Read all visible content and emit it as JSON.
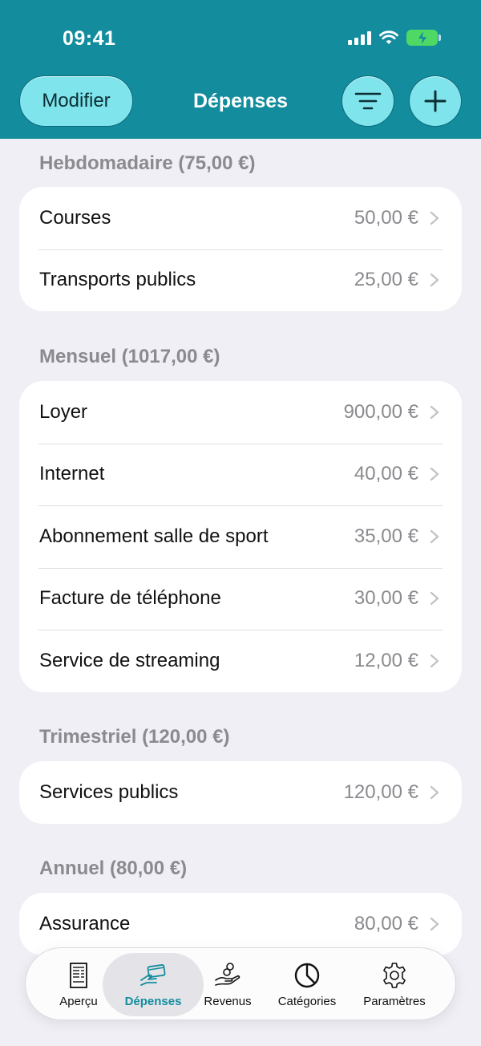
{
  "status_bar": {
    "time": "09:41"
  },
  "nav": {
    "edit_label": "Modifier",
    "title": "Dépenses",
    "filter_icon": "filter-lines-icon",
    "add_icon": "plus-icon"
  },
  "sections": [
    {
      "title": "Hebdomadaire (75,00 €)",
      "items": [
        {
          "label": "Courses",
          "value": "50,00 €"
        },
        {
          "label": "Transports publics",
          "value": "25,00 €"
        }
      ]
    },
    {
      "title": "Mensuel (1017,00 €)",
      "items": [
        {
          "label": "Loyer",
          "value": "900,00 €"
        },
        {
          "label": "Internet",
          "value": "40,00 €"
        },
        {
          "label": "Abonnement salle de sport",
          "value": "35,00 €"
        },
        {
          "label": "Facture de téléphone",
          "value": "30,00 €"
        },
        {
          "label": "Service de streaming",
          "value": "12,00 €"
        }
      ]
    },
    {
      "title": "Trimestriel (120,00 €)",
      "items": [
        {
          "label": "Services publics",
          "value": "120,00 €"
        }
      ]
    },
    {
      "title": "Annuel (80,00 €)",
      "items": [
        {
          "label": "Assurance",
          "value": "80,00 €"
        }
      ]
    }
  ],
  "tabbar": {
    "tabs": [
      {
        "label": "Aperçu",
        "icon": "receipt-icon"
      },
      {
        "label": "Dépenses",
        "icon": "card-payment-icon",
        "active": true
      },
      {
        "label": "Revenus",
        "icon": "hand-coins-icon"
      },
      {
        "label": "Catégories",
        "icon": "pie-chart-icon"
      },
      {
        "label": "Paramètres",
        "icon": "gear-icon"
      }
    ]
  },
  "colors": {
    "accent": "#138c9e",
    "button_fill": "#7fe4ec",
    "background": "#f0eff5",
    "secondary_text": "#8a8a8f"
  }
}
